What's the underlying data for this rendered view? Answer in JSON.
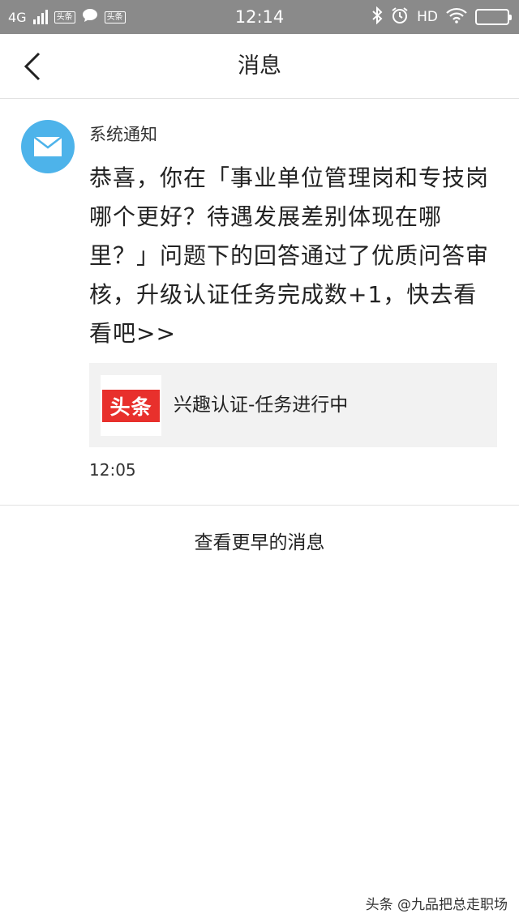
{
  "status_bar": {
    "network": "4G",
    "app_badges": [
      "头条",
      "头条"
    ],
    "time": "12:14",
    "hd": "HD"
  },
  "header": {
    "title": "消息",
    "back_icon": "chevron-left-icon"
  },
  "message": {
    "avatar_icon": "mail-icon",
    "avatar_color": "#4db3ea",
    "sender": "系统通知",
    "body": "恭喜，你在「事业单位管理岗和专技岗哪个更好？待遇发展差别体现在哪里？」问题下的回答通过了优质问答审核，升级认证任务完成数+1，快去看看吧>>",
    "card": {
      "logo_text": "头条",
      "logo_color": "#e8302c",
      "title": "兴趣认证-任务进行中"
    },
    "time": "12:05"
  },
  "more_link": "查看更早的消息",
  "watermark": "头条 @九品把总走职场"
}
